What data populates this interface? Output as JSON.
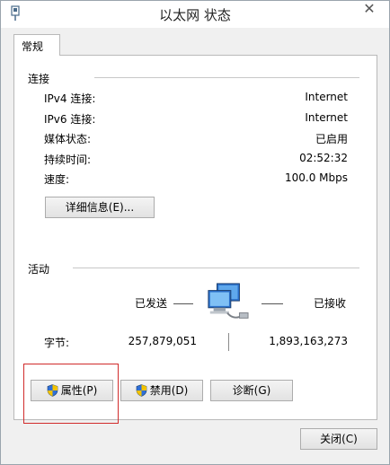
{
  "window": {
    "title": "以太网 状态",
    "close_glyph": "✕"
  },
  "tabs": [
    {
      "label": "常规"
    }
  ],
  "connection": {
    "heading": "连接",
    "rows": [
      {
        "label": "IPv4 连接:",
        "value": "Internet"
      },
      {
        "label": "IPv6 连接:",
        "value": "Internet"
      },
      {
        "label": "媒体状态:",
        "value": "已启用"
      },
      {
        "label": "持续时间:",
        "value": "02:52:32"
      },
      {
        "label": "速度:",
        "value": "100.0 Mbps"
      }
    ],
    "details_button": "详细信息(E)..."
  },
  "activity": {
    "heading": "活动",
    "sent_label": "已发送",
    "received_label": "已接收",
    "bytes_label": "字节:",
    "bytes_sent": "257,879,051",
    "bytes_received": "1,893,163,273"
  },
  "buttons": {
    "properties": "属性(P)",
    "disable": "禁用(D)",
    "diagnose": "诊断(G)",
    "close": "关闭(C)"
  },
  "icons": {
    "app": "network-adapter-icon",
    "network": "network-computers-icon",
    "shield": "uac-shield-icon"
  },
  "colors": {
    "highlight": "#d12b2b",
    "panel_border": "#b9b9b9"
  }
}
